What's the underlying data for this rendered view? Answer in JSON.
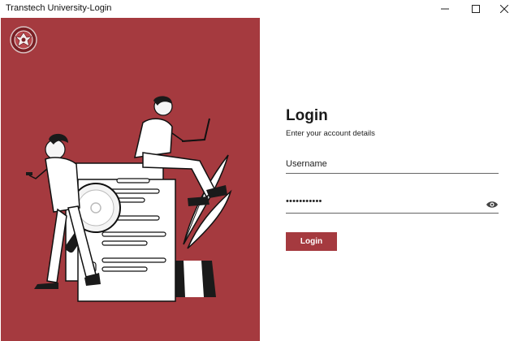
{
  "window": {
    "title": "Transtech University-Login"
  },
  "brand": {
    "accent": "#a53a3f",
    "logo_icon": "university-crest-icon"
  },
  "login": {
    "title": "Login",
    "subtitle": "Enter your account details",
    "username_label": "Username",
    "password_value": "•••••••••••",
    "show_password_icon": "eye-icon",
    "button_label": "Login"
  }
}
